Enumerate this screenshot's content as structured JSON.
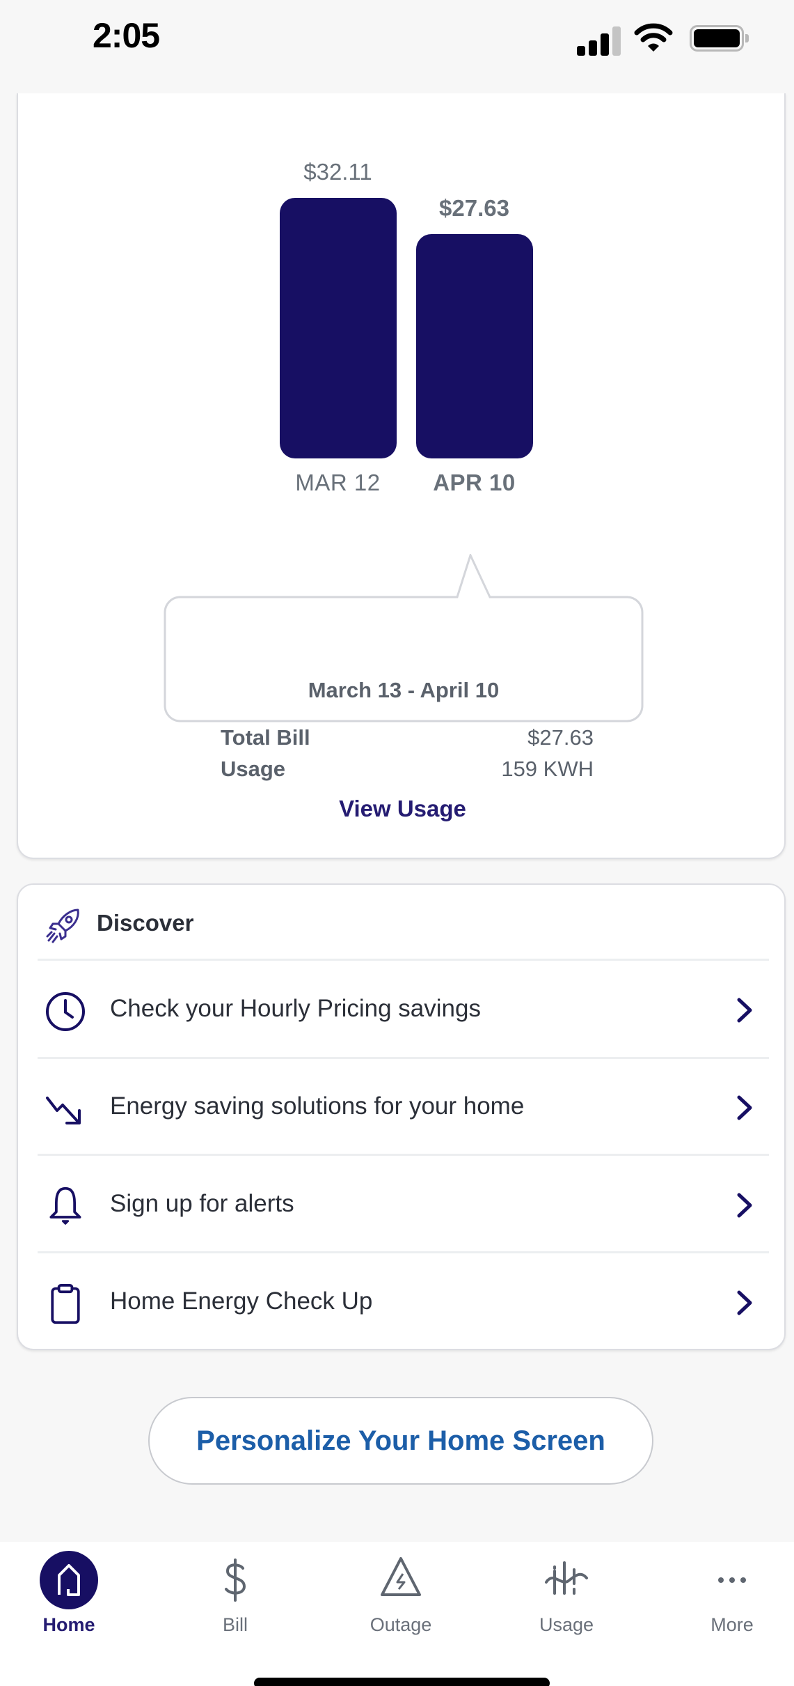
{
  "status_bar": {
    "time": "2:05",
    "signal_bars_filled": 3,
    "signal_bars_total": 4,
    "wifi_icon": "wifi-icon",
    "battery_icon": "battery-full-icon"
  },
  "usage_card": {
    "tooltip": {
      "date_range": "March 13 - April 10",
      "rows": [
        {
          "label": "Total Bill",
          "value": "$27.63"
        },
        {
          "label": "Usage",
          "value": "159 KWH"
        }
      ]
    },
    "view_usage_label": "View Usage"
  },
  "chart_data": {
    "type": "bar",
    "title": "",
    "xlabel": "",
    "ylabel": "",
    "categories": [
      "MAR 12",
      "APR 10"
    ],
    "values": [
      32.11,
      27.63
    ],
    "value_labels": [
      "$32.11",
      "$27.63"
    ],
    "selected_index": 1,
    "ylim": [
      0,
      32.11
    ],
    "grid": false,
    "bar_color": "#170f63"
  },
  "discover": {
    "title": "Discover",
    "icon": "rocket-icon",
    "items": [
      {
        "label": "Check your Hourly Pricing savings",
        "icon": "clock-icon"
      },
      {
        "label": "Energy saving solutions for your home",
        "icon": "trend-down-icon"
      },
      {
        "label": "Sign up for alerts",
        "icon": "bell-icon"
      },
      {
        "label": "Home Energy Check Up",
        "icon": "clipboard-icon"
      }
    ]
  },
  "personalize_button": "Personalize Your Home Screen",
  "bottom_nav": {
    "items": [
      {
        "label": "Home",
        "icon": "home-icon",
        "active": true
      },
      {
        "label": "Bill",
        "icon": "dollar-icon",
        "active": false
      },
      {
        "label": "Outage",
        "icon": "outage-warning-icon",
        "active": false
      },
      {
        "label": "Usage",
        "icon": "usage-meter-icon",
        "active": false
      },
      {
        "label": "More",
        "icon": "more-dots-icon",
        "active": false
      }
    ]
  },
  "colors": {
    "brand_navy": "#170f63",
    "link_navy": "#251c72",
    "link_blue": "#1c5ea8",
    "text_gray": "#687079",
    "background": "#f7f7f7"
  }
}
